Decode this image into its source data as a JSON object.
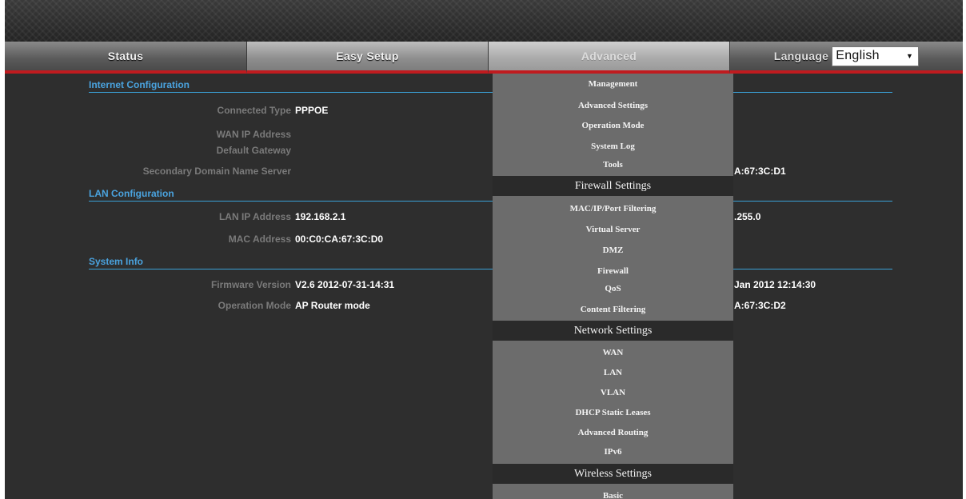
{
  "nav": {
    "tabs": [
      "Status",
      "Easy Setup",
      "Advanced"
    ],
    "language_label": "Language",
    "language_value": "English"
  },
  "internet": {
    "heading": "Internet Configuration",
    "rows": [
      {
        "label": "Connected Type",
        "value": "PPPOE"
      },
      {
        "label": "WAN IP Address",
        "value": ""
      },
      {
        "label": "Default Gateway",
        "value": ""
      },
      {
        "label": "Secondary Domain Name Server",
        "value": ""
      }
    ],
    "right_value": "A:67:3C:D1"
  },
  "lan": {
    "heading": "LAN Configuration",
    "rows": [
      {
        "label": "LAN IP Address",
        "value": "192.168.2.1"
      },
      {
        "label": "MAC Address",
        "value": "00:C0:CA:67:3C:D0"
      }
    ],
    "right_value": ".255.0"
  },
  "system": {
    "heading": "System Info",
    "rows": [
      {
        "label": "Firmware Version",
        "value": "V2.6  2012-07-31-14:31"
      },
      {
        "label": "Operation Mode",
        "value": "AP Router mode"
      }
    ],
    "right_values": [
      "Jan 2012 12:14:30",
      "A:67:3C:D2"
    ]
  },
  "menu": {
    "items_top": [
      "Management",
      "Advanced Settings",
      "Operation Mode",
      "System Log",
      "Tools"
    ],
    "firewall_header": "Firewall Settings",
    "firewall_items": [
      "MAC/IP/Port Filtering",
      "Virtual Server",
      "DMZ",
      "Firewall",
      "QoS",
      "Content Filtering"
    ],
    "network_header": "Network Settings",
    "network_items": [
      "WAN",
      "LAN",
      "VLAN",
      "DHCP Static Leases",
      "Advanced Routing",
      "IPv6"
    ],
    "wireless_header": "Wireless Settings",
    "wireless_items": [
      "Basic"
    ]
  }
}
